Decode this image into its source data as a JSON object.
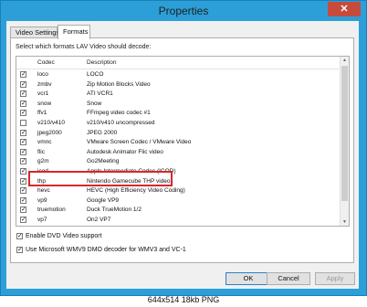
{
  "window": {
    "title": "Properties",
    "close_glyph": "✕"
  },
  "tabs": [
    {
      "label": "Video Settings",
      "active": false
    },
    {
      "label": "Formats",
      "active": true
    }
  ],
  "instruction": "Select which formats LAV Video should decode:",
  "list": {
    "headers": {
      "codec": "Codec",
      "description": "Description"
    },
    "rows": [
      {
        "codec": "loco",
        "desc": "LOCO",
        "checked": true
      },
      {
        "codec": "zmbv",
        "desc": "Zip Motion Blocks Video",
        "checked": true
      },
      {
        "codec": "vcr1",
        "desc": "ATI VCR1",
        "checked": true
      },
      {
        "codec": "snow",
        "desc": "Snow",
        "checked": true
      },
      {
        "codec": "ffv1",
        "desc": "FFmpeg video codec #1",
        "checked": true
      },
      {
        "codec": "v210/v410",
        "desc": "v210/v410 uncompressed",
        "checked": false
      },
      {
        "codec": "jpeg2000",
        "desc": "JPEG 2000",
        "checked": true
      },
      {
        "codec": "vmnc",
        "desc": "VMware Screen Codec / VMware Video",
        "checked": true
      },
      {
        "codec": "flic",
        "desc": "Autodesk Animator Flic video",
        "checked": true
      },
      {
        "codec": "g2m",
        "desc": "Go2Meeting",
        "checked": true
      },
      {
        "codec": "icod",
        "desc": "Apple Intermediate Codec (ICOD)",
        "checked": true
      },
      {
        "codec": "thp",
        "desc": "Nintendo Gamecube THP video",
        "checked": true
      },
      {
        "codec": "hevc",
        "desc": "HEVC (High Efficiency Video Coding)",
        "checked": true
      },
      {
        "codec": "vp9",
        "desc": "Google VP9",
        "checked": true
      },
      {
        "codec": "truemotion",
        "desc": "Duck TrueMotion 1/2",
        "checked": true
      },
      {
        "codec": "vp7",
        "desc": "On2 VP7",
        "checked": true
      }
    ]
  },
  "options": {
    "dvd": {
      "label": "Enable DVD Video support",
      "checked": true
    },
    "wmv": {
      "label": "Use Microsoft WMV9 DMO decoder for WMV3 and VC-1",
      "checked": true
    }
  },
  "buttons": {
    "ok": "OK",
    "cancel": "Cancel",
    "apply": "Apply"
  },
  "caption": "644x514 18kb PNG",
  "colors": {
    "titlebar": "#2c9fd8",
    "highlight": "#d8272a",
    "close": "#c74b3c"
  }
}
